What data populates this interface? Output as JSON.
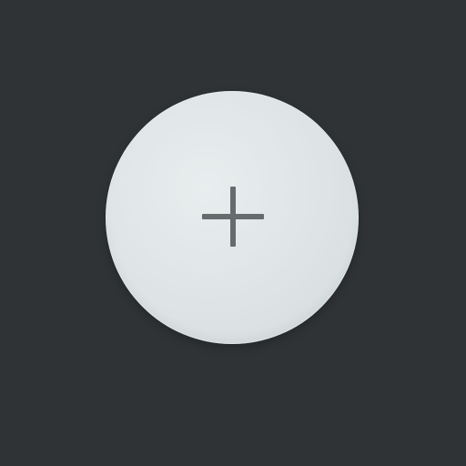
{
  "add_button": {
    "icon": "plus-icon",
    "colors": {
      "background": "#2f3336",
      "button": "#dde3e5",
      "icon": "#666b6d"
    }
  }
}
